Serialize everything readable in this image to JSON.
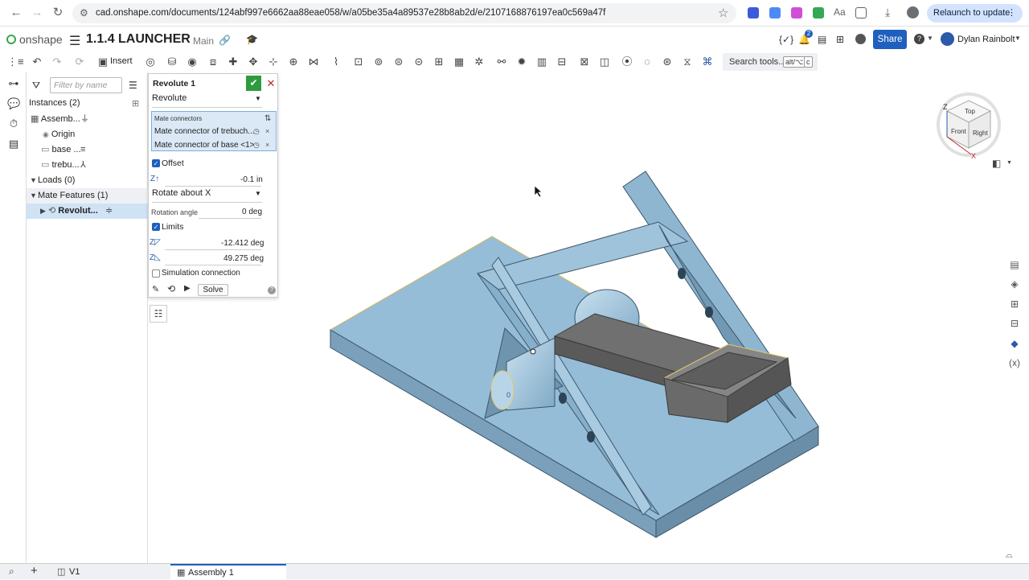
{
  "browser": {
    "url": "cad.onshape.com/documents/124abf997e6662aa88eae058/w/a05be35a4a89537e28b8ab2d/e/2107168876197ea0c569a47f",
    "relaunch_label": "Relaunch to update"
  },
  "header": {
    "app_name": "onshape",
    "doc_title": "1.1.4 LAUNCHER",
    "branch": "Main",
    "notification_count": "2",
    "share_label": "Share",
    "user_name": "Dylan Rainbolt"
  },
  "toolbar": {
    "insert_label": "Insert",
    "search_label": "Search tools...",
    "search_shortcut_1": "alt/⌥",
    "search_shortcut_2": "c"
  },
  "tree": {
    "filter_placeholder": "Filter by name",
    "instances_label": "Instances (2)",
    "items": [
      {
        "label": "Assemb..."
      },
      {
        "label": "Origin"
      },
      {
        "label": "base ..."
      },
      {
        "label": "trebu..."
      }
    ],
    "loads_label": "Loads (0)",
    "mate_features_label": "Mate Features (1)",
    "mate_item_label": "Revolut..."
  },
  "dialog": {
    "title": "Revolute 1",
    "type_value": "Revolute",
    "mate_connectors_label": "Mate connectors",
    "connector_1": "Mate connector of trebuch...",
    "connector_2": "Mate connector of base <1>",
    "offset_label": "Offset",
    "offset_value": "-0.1 in",
    "rotate_value": "Rotate about X",
    "rotation_angle_label": "Rotation angle",
    "rotation_angle_value": "0 deg",
    "limits_label": "Limits",
    "limit_min": "-12.412 deg",
    "limit_max": "49.275 deg",
    "simulation_label": "Simulation connection",
    "solve_label": "Solve"
  },
  "viewcube": {
    "top": "Top",
    "front": "Front",
    "right": "Right",
    "axis_z": "Z",
    "axis_x": "X"
  },
  "bottom": {
    "version_label": "V1",
    "tab_label": "Assembly 1"
  },
  "colors": {
    "part_blue": "#8fb9d6",
    "arm_gray": "#6d6d6d",
    "accent": "#1f5fbf",
    "selection": "#cfe3f5"
  }
}
